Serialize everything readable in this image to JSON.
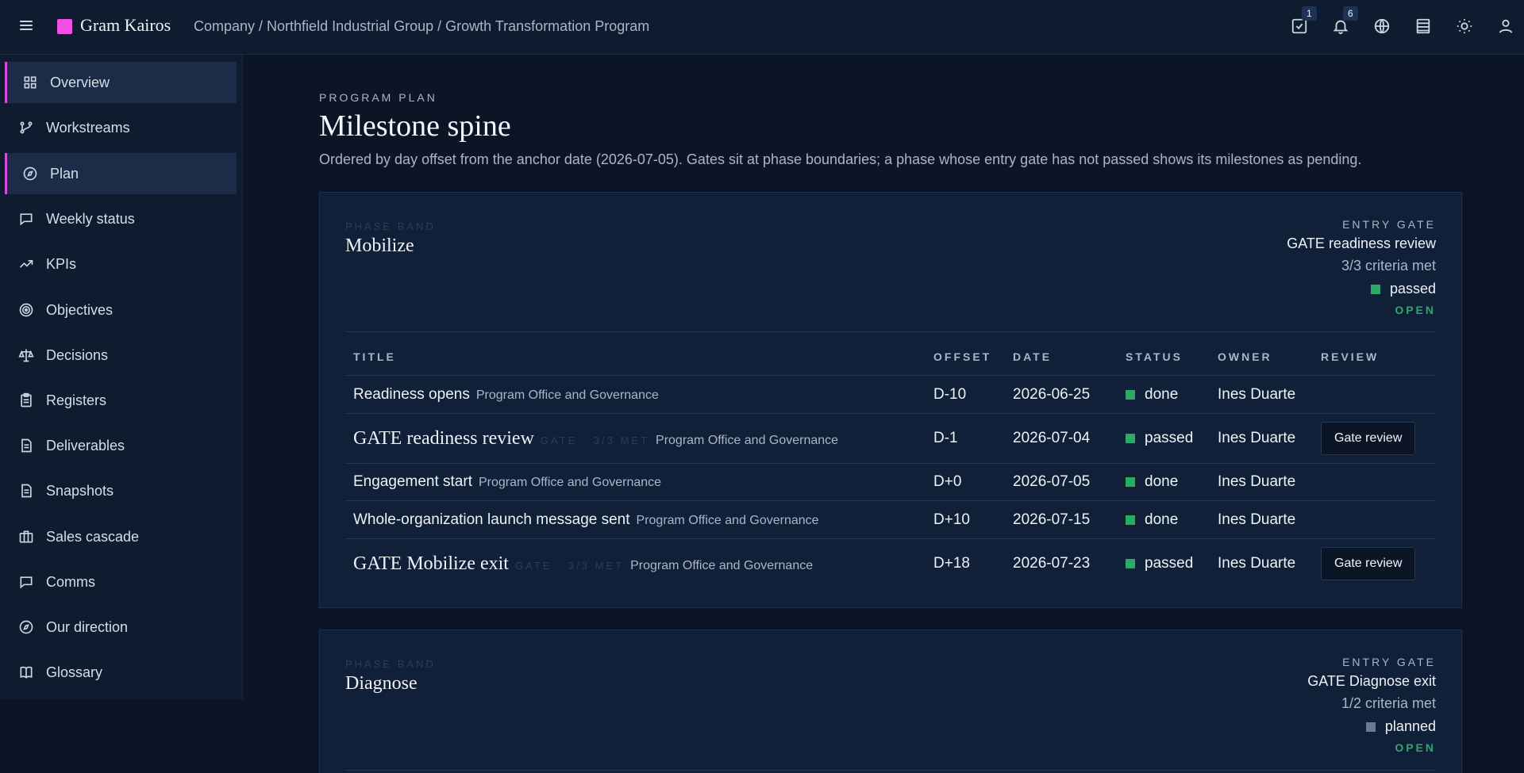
{
  "header": {
    "brand": "Gram Kairos",
    "brand_color": "#f04fe6",
    "breadcrumb": "Company / Northfield Industrial Group / Growth Transformation Program",
    "tasks_badge": "1",
    "notifications_badge": "6",
    "icons": [
      "menu-icon",
      "tasks-icon",
      "bell-icon",
      "globe-icon",
      "table-icon",
      "sun-icon",
      "user-icon"
    ]
  },
  "sidebar": {
    "items": [
      {
        "label": "Overview",
        "icon": "grid-icon"
      },
      {
        "label": "Workstreams",
        "icon": "branch-icon"
      },
      {
        "label": "Plan",
        "icon": "compass-icon"
      },
      {
        "label": "Weekly status",
        "icon": "chat-icon"
      },
      {
        "label": "KPIs",
        "icon": "trend-icon"
      },
      {
        "label": "Objectives",
        "icon": "target-icon"
      },
      {
        "label": "Decisions",
        "icon": "scale-icon"
      },
      {
        "label": "Registers",
        "icon": "clipboard-icon"
      },
      {
        "label": "Deliverables",
        "icon": "document-icon"
      },
      {
        "label": "Snapshots",
        "icon": "document-icon"
      },
      {
        "label": "Sales cascade",
        "icon": "briefcase-icon"
      },
      {
        "label": "Comms",
        "icon": "chat-icon"
      },
      {
        "label": "Our direction",
        "icon": "compass-icon"
      },
      {
        "label": "Glossary",
        "icon": "book-icon"
      }
    ],
    "active": [
      "Overview",
      "Plan"
    ]
  },
  "main": {
    "eyebrow": "PROGRAM PLAN",
    "title": "Milestone spine",
    "subtitle": "Ordered by day offset from the anchor date (2026-07-05). Gates sit at phase boundaries; a phase whose entry gate has not passed shows its milestones as pending."
  },
  "phases": [
    {
      "eyebrow": "PHASE BAND",
      "name": "Mobilize",
      "gate": {
        "eyebrow": "ENTRY GATE",
        "name": "GATE readiness review",
        "criteria": "3/3 criteria met",
        "status": "passed",
        "status_color": "#2ea864",
        "state": "OPEN"
      },
      "columns": [
        "TITLE",
        "OFFSET",
        "DATE",
        "STATUS",
        "OWNER",
        "REVIEW"
      ],
      "milestones": [
        {
          "title": "Readiness opens",
          "gate": false,
          "meta": "",
          "workstream": "Program Office and Governance",
          "offset": "D-10",
          "date": "2026-06-25",
          "status": "done",
          "owner": "Ines Duarte",
          "review": ""
        },
        {
          "title": "GATE readiness review",
          "gate": true,
          "meta": "GATE · 3/3 MET",
          "workstream": "Program Office and Governance",
          "offset": "D-1",
          "date": "2026-07-04",
          "status": "passed",
          "owner": "Ines Duarte",
          "review": "Gate review"
        },
        {
          "title": "Engagement start",
          "gate": false,
          "meta": "",
          "workstream": "Program Office and Governance",
          "offset": "D+0",
          "date": "2026-07-05",
          "status": "done",
          "owner": "Ines Duarte",
          "review": ""
        },
        {
          "title": "Whole-organization launch message sent",
          "gate": false,
          "meta": "",
          "workstream": "Program Office and Governance",
          "offset": "D+10",
          "date": "2026-07-15",
          "status": "done",
          "owner": "Ines Duarte",
          "review": ""
        },
        {
          "title": "GATE Mobilize exit",
          "gate": true,
          "meta": "GATE · 3/3 MET",
          "workstream": "Program Office and Governance",
          "offset": "D+18",
          "date": "2026-07-23",
          "status": "passed",
          "owner": "Ines Duarte",
          "review": "Gate review"
        }
      ]
    },
    {
      "eyebrow": "PHASE BAND",
      "name": "Diagnose",
      "gate": {
        "eyebrow": "ENTRY GATE",
        "name": "GATE Diagnose exit",
        "criteria": "1/2 criteria met",
        "status": "planned",
        "status_color": "#6b7a90",
        "state": "OPEN"
      }
    }
  ],
  "colors": {
    "done": "#2ea864",
    "passed": "#2ea864",
    "planned": "#6b7a90",
    "active_accent": "#d54dd8"
  }
}
